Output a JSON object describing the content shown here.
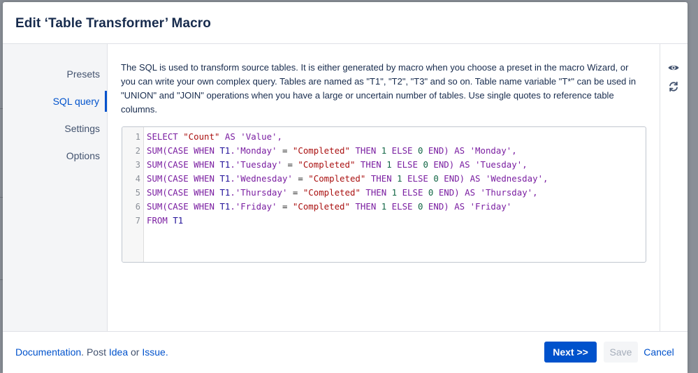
{
  "dialog": {
    "title": "Edit ‘Table Transformer’ Macro"
  },
  "sidebar": {
    "items": [
      {
        "label": "Presets",
        "active": false
      },
      {
        "label": "SQL query",
        "active": true
      },
      {
        "label": "Settings",
        "active": false
      },
      {
        "label": "Options",
        "active": false
      }
    ]
  },
  "content": {
    "description": "The SQL is used to transform source tables. It is either generated by macro when you choose a preset in the macro Wizard, or you can write your own complex query. Tables are named as \"T1\", \"T2\", \"T3\" and so on. Table name variable \"T*\" can be used in \"UNION\" and \"JOIN\" operations when you have a large or uncertain number of tables. Use single quotes to reference table columns."
  },
  "editor": {
    "line_numbers": [
      "1",
      "2",
      "3",
      "4",
      "5",
      "6",
      "7"
    ],
    "lines": [
      "SELECT \"Count\" AS 'Value',",
      "SUM(CASE WHEN T1.'Monday' = \"Completed\" THEN 1 ELSE 0 END) AS 'Monday',",
      "SUM(CASE WHEN T1.'Tuesday' = \"Completed\" THEN 1 ELSE 0 END) AS 'Tuesday',",
      "SUM(CASE WHEN T1.'Wednesday' = \"Completed\" THEN 1 ELSE 0 END) AS 'Wednesday',",
      "SUM(CASE WHEN T1.'Thursday' = \"Completed\" THEN 1 ELSE 0 END) AS 'Thursday',",
      "SUM(CASE WHEN T1.'Friday' = \"Completed\" THEN 1 ELSE 0 END) AS 'Friday'",
      "FROM T1"
    ]
  },
  "toolbar": {
    "icons": [
      "eye-icon",
      "refresh-icon"
    ]
  },
  "footer": {
    "documentation_link": "Documentation",
    "post_text": ". Post ",
    "idea_link": "Idea",
    "or_text": " or ",
    "issue_link": "Issue",
    "period": ".",
    "next_label": "Next >>",
    "save_label": "Save",
    "cancel_label": "Cancel"
  },
  "colors": {
    "accent": "#0052cc",
    "text": "#172b4d",
    "keyword": "#7a1ea1",
    "string": "#aa1111",
    "number": "#116644"
  }
}
